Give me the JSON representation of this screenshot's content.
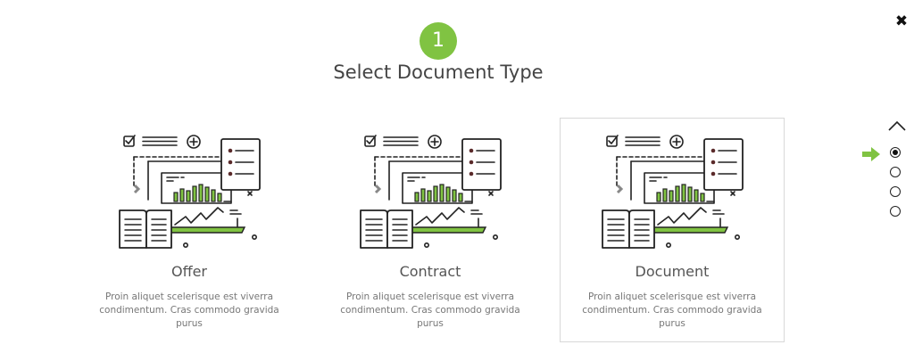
{
  "close_label": "✖",
  "step": {
    "number": "1"
  },
  "title": "Select Document Type",
  "cards": [
    {
      "title": "Offer",
      "description": "Proin aliquet scelerisque est viverra condimentum. Cras commodo gravida purus",
      "selected": false
    },
    {
      "title": "Contract",
      "description": "Proin aliquet scelerisque est viverra condimentum. Cras commodo gravida purus",
      "selected": false
    },
    {
      "title": "Document",
      "description": "Proin aliquet scelerisque est viverra condimentum. Cras commodo gravida purus",
      "selected": true
    }
  ],
  "pager": {
    "total": 4,
    "active_index": 0
  },
  "colors": {
    "accent": "#80c342",
    "bullet": "#5a2a2a",
    "text": "#444444"
  }
}
